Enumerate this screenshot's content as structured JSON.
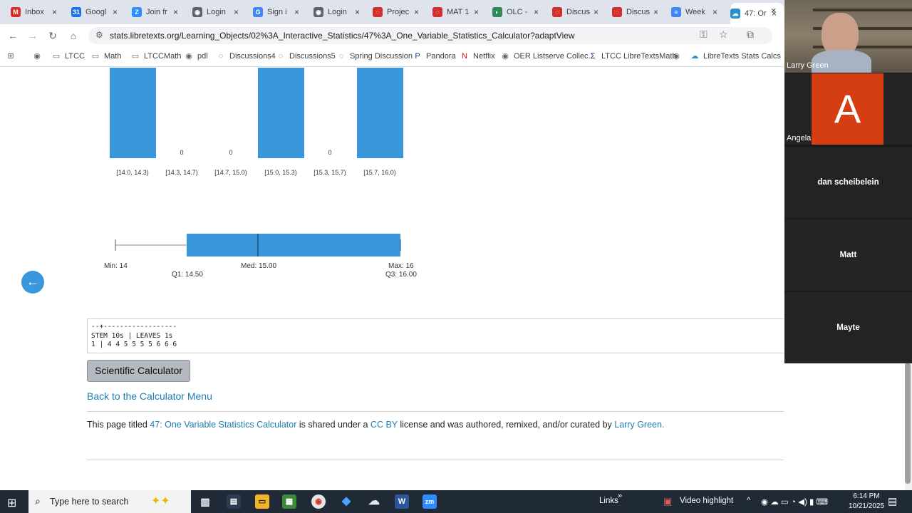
{
  "browser": {
    "tabs": [
      {
        "label": "Inbox",
        "icon": "gmail-icon",
        "color": "#d93025",
        "glyph": "M"
      },
      {
        "label": "Googl",
        "icon": "google-calendar-icon",
        "color": "#1a73e8",
        "glyph": "31"
      },
      {
        "label": "Join fr",
        "icon": "zoom-icon",
        "color": "#2d8cff",
        "glyph": "Z"
      },
      {
        "label": "Login",
        "icon": "globe-icon",
        "color": "#5f6368",
        "glyph": "◉"
      },
      {
        "label": "Sign i",
        "icon": "google-icon",
        "color": "#4285f4",
        "glyph": "G"
      },
      {
        "label": "Login",
        "icon": "globe-icon",
        "color": "#5f6368",
        "glyph": "◉"
      },
      {
        "label": "Projec",
        "icon": "discussions-icon",
        "color": "#d32f2f",
        "glyph": "◌"
      },
      {
        "label": "MAT 1",
        "icon": "discussions-icon",
        "color": "#d32f2f",
        "glyph": "◌"
      },
      {
        "label": "OLC -",
        "icon": "olc-icon",
        "color": "#2e8b57",
        "glyph": "◐"
      },
      {
        "label": "Discus",
        "icon": "discussions-icon",
        "color": "#d32f2f",
        "glyph": "◌"
      },
      {
        "label": "Discus",
        "icon": "discussions-icon",
        "color": "#d32f2f",
        "glyph": "◌"
      },
      {
        "label": "Week",
        "icon": "docs-icon",
        "color": "#4285f4",
        "glyph": "≡"
      },
      {
        "label": "47: Or",
        "icon": "libretexts-icon",
        "color": "#2a8fcf",
        "glyph": "☁"
      }
    ],
    "url": "stats.libretexts.org/Learning_Objects/02%3A_Interactive_Statistics/47%3A_One_Variable_Statistics_Calculator?adaptView",
    "bookmarks": [
      {
        "label": "",
        "icon": "apps-grid-icon",
        "glyph": "⊞"
      },
      {
        "label": "",
        "icon": "globe-icon",
        "glyph": "◉"
      },
      {
        "label": "LTCC",
        "icon": "folder-icon",
        "glyph": "▭"
      },
      {
        "label": "Math",
        "icon": "folder-icon",
        "glyph": "▭"
      },
      {
        "label": "LTCCMath",
        "icon": "folder-icon",
        "glyph": "▭"
      },
      {
        "label": "pdl",
        "icon": "globe-icon",
        "glyph": "◉"
      },
      {
        "label": "Discussions4",
        "icon": "discussions-icon",
        "glyph": "◌"
      },
      {
        "label": "Discussions5",
        "icon": "discussions-icon",
        "glyph": "◌"
      },
      {
        "label": "Spring Discussion",
        "icon": "discussions-icon",
        "glyph": "◌"
      },
      {
        "label": "Pandora",
        "icon": "pandora-icon",
        "glyph": "P"
      },
      {
        "label": "Netflix",
        "icon": "netflix-icon",
        "glyph": "N"
      },
      {
        "label": "OER Listserve Collec...",
        "icon": "globe-icon",
        "glyph": "◉"
      },
      {
        "label": "LTCC LibreTextsMath",
        "icon": "sigma-icon",
        "glyph": "Σ"
      },
      {
        "label": "",
        "icon": "globe-icon",
        "glyph": "◉"
      },
      {
        "label": "LibreTexts Stats Calcs",
        "icon": "libretexts-icon",
        "glyph": "☁"
      }
    ]
  },
  "page": {
    "histogram": {
      "bins": [
        "[14.0, 14.3)",
        "[14.3, 14.7)",
        "[14.7, 15.0)",
        "[15.0, 15.3)",
        "[15.3, 15.7)",
        "[15.7, 16.0)"
      ],
      "zero_labels": [
        "0",
        "0",
        "0"
      ],
      "bar_color": "#3a97dc"
    },
    "boxplot": {
      "min_label": "Min: 14",
      "q1_label": "Q1: 14.50",
      "med_label": "Med: 15.00",
      "max_label": "Max: 16",
      "q3_label": "Q3: 16.00",
      "min": 14,
      "q1": 14.5,
      "median": 15.0,
      "q3": 16.0,
      "max": 16
    },
    "stem_leaf": {
      "line1": "--+------------------",
      "line2": "STEM 10s | LEAVES 1s",
      "line3": "1 | 4 4 5 5 5 5 6 6 6"
    },
    "calculator_button": "Scientific Calculator",
    "back_link": "Back to the Calculator Menu",
    "license": {
      "prefix": "This page titled ",
      "title_link": "47: One Variable Statistics Calculator",
      "mid1": " is shared under a ",
      "license_link": "CC BY",
      "mid2": " license and was authored, remixed, and/or curated by ",
      "author_link": "Larry Green."
    }
  },
  "zoom": {
    "participants": [
      {
        "name": "Larry Green"
      },
      {
        "name": "Angela Mafi",
        "initial": "A"
      },
      {
        "name": "dan scheibelein"
      },
      {
        "name": "Matt"
      },
      {
        "name": "Mayte"
      }
    ]
  },
  "taskbar": {
    "search_placeholder": "Type here to search",
    "links_label": "Links",
    "video_highlight": "Video highlight",
    "time": "6:14 PM",
    "date": "10/21/2025"
  }
}
